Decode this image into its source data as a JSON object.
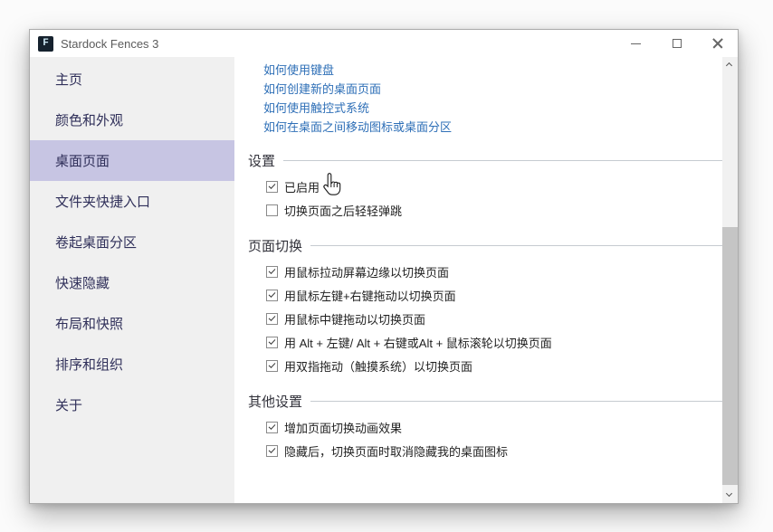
{
  "window": {
    "title": "Stardock Fences 3",
    "app_icon_letter": "F",
    "controls": {
      "minimize": "minimize",
      "maximize": "maximize",
      "close": "close"
    }
  },
  "sidebar": {
    "items": [
      {
        "label": "主页",
        "selected": false
      },
      {
        "label": "颜色和外观",
        "selected": false
      },
      {
        "label": "桌面页面",
        "selected": true
      },
      {
        "label": "文件夹快捷入口",
        "selected": false
      },
      {
        "label": "卷起桌面分区",
        "selected": false
      },
      {
        "label": "快速隐藏",
        "selected": false
      },
      {
        "label": "布局和快照",
        "selected": false
      },
      {
        "label": "排序和组织",
        "selected": false
      },
      {
        "label": "关于",
        "selected": false
      }
    ]
  },
  "content": {
    "help_links": [
      "如何使用键盘",
      "如何创建新的桌面页面",
      "如何使用触控式系统",
      "如何在桌面之间移动图标或桌面分区"
    ],
    "sections": [
      {
        "title": "设置",
        "options": [
          {
            "label": "已启用",
            "checked": true
          },
          {
            "label": "切换页面之后轻轻弹跳",
            "checked": false
          }
        ]
      },
      {
        "title": "页面切换",
        "options": [
          {
            "label": "用鼠标拉动屏幕边缘以切换页面",
            "checked": true
          },
          {
            "label": "用鼠标左键+右键拖动以切换页面",
            "checked": true
          },
          {
            "label": "用鼠标中键拖动以切换页面",
            "checked": true
          },
          {
            "label": "用 Alt + 左键/ Alt + 右键或Alt + 鼠标滚轮以切换页面",
            "checked": true
          },
          {
            "label": "用双指拖动（触摸系统）以切换页面",
            "checked": true
          }
        ]
      },
      {
        "title": "其他设置",
        "options": [
          {
            "label": "增加页面切换动画效果",
            "checked": true
          },
          {
            "label": "隐藏后，切换页面时取消隐藏我的桌面图标",
            "checked": true
          }
        ]
      }
    ]
  },
  "colors": {
    "sidebar_bg": "#f0f0f0",
    "sidebar_selected_bg": "#c7c5e3",
    "sidebar_text": "#30305a",
    "link": "#2e6fb7",
    "section_line": "#c6cbd1",
    "title_text": "#5b5b5b"
  }
}
